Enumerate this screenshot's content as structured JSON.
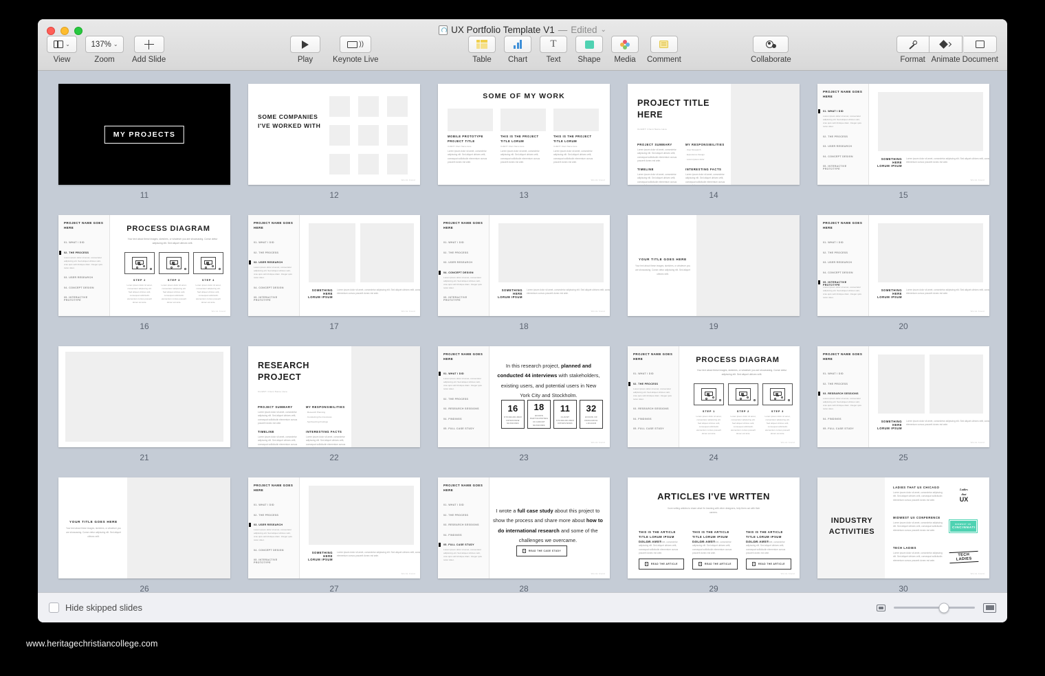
{
  "window": {
    "doc_title": "UX Portfolio Template V1",
    "separator": "—",
    "edited_label": "Edited",
    "caret": "⌄"
  },
  "toolbar": {
    "left": [
      {
        "name": "view",
        "label": "View",
        "icon": "panel-icon",
        "has_caret": true
      },
      {
        "name": "zoom",
        "label": "Zoom",
        "value": "137%",
        "icon": "zoom-value",
        "has_caret": true
      },
      {
        "name": "add-slide",
        "label": "Add Slide",
        "icon": "plus-icon",
        "has_caret": false
      }
    ],
    "center_play": [
      {
        "name": "play",
        "label": "Play",
        "icon": "play-icon"
      },
      {
        "name": "keynote-live",
        "label": "Keynote Live",
        "icon": "keynote-live-icon"
      }
    ],
    "insert": [
      {
        "name": "table",
        "label": "Table",
        "icon": "table-icon",
        "color": "#f0cf4a"
      },
      {
        "name": "chart",
        "label": "Chart",
        "icon": "chart-icon",
        "color": "#3d8fd8"
      },
      {
        "name": "text",
        "label": "Text",
        "icon": "text-icon",
        "color": "#5a5a5a"
      },
      {
        "name": "shape",
        "label": "Shape",
        "icon": "shape-icon",
        "color": "#4fd2b2"
      },
      {
        "name": "media",
        "label": "Media",
        "icon": "media-icon",
        "color": "#e05b7a"
      },
      {
        "name": "comment",
        "label": "Comment",
        "icon": "comment-icon",
        "color": "#f0cf4a"
      }
    ],
    "collaborate": {
      "name": "collaborate",
      "label": "Collaborate",
      "icon": "collaborate-icon"
    },
    "right": [
      {
        "name": "format",
        "label": "Format",
        "icon": "format-brush-icon"
      },
      {
        "name": "animate",
        "label": "Animate",
        "icon": "animate-diamond-icon"
      },
      {
        "name": "document",
        "label": "Document",
        "icon": "document-square-icon"
      }
    ]
  },
  "bottom_bar": {
    "hide_skipped_label": "Hide skipped slides",
    "hide_skipped_checked": false,
    "zoom_small_icon": "small-thumbnails-icon",
    "zoom_large_icon": "large-thumbnails-icon",
    "slider_position_pct": 62
  },
  "watermark": "www.heritagechristiancollege.com",
  "common": {
    "project_name": "PROJECT NAME GOES HERE",
    "footer_mark": "Words brand",
    "something_here": "SOMETHING HERE",
    "lorum_ipsum": "LORUM IPSUM",
    "caption_body": "Lorem ipsum dolor sit amet, consectetur adipiscing elit. Sed aliquet ultrices velit, consequat sollicitudin elementum cursus posuerit donec est ante.",
    "sidebar_body": "Lorem ipsum dolor sit amet, consectetur adipiscing elit. Sed aliquet ultrices velit, cras quis velit tristique diam. Integer quis tortor dolor.",
    "client_line": "CLIENT: Client Name Here",
    "nav_project": [
      "01. WHAT I DID",
      "02. THE PROCESS",
      "03. USER RESEARCH",
      "04. CONCEPT DESIGN",
      "05. INTERACTIVE PROTOTYPE"
    ],
    "nav_research": [
      "01. WHAT I DID",
      "02. THE PROCESS",
      "03. RESEARCH SESSIONS",
      "04. FINDINGS",
      "05. FULL CASE STUDY"
    ],
    "your_title_goes_here": "YOUR TITLE GOES HERE",
    "your_title_body": "Your text about these images, sketches, or whatever you are showcasing. Conse ctetur adipiscing elit. Sed aliquet ultrices velit."
  },
  "slides": [
    {
      "number": "11",
      "name": "my-projects-cover",
      "layout": "cover-dark",
      "title": "MY PROJECTS"
    },
    {
      "number": "12",
      "name": "companies-worked-with",
      "layout": "companies",
      "title": "SOME COMPANIES I'VE WORKED WITH",
      "logo_slots": 9
    },
    {
      "number": "13",
      "name": "some-of-my-work",
      "layout": "work-grid",
      "title": "SOME OF MY WORK",
      "cards": [
        {
          "title": "MOBILE PROTOTYPE PROJECT TITLE",
          "client": "CLIENT: Client Name Here"
        },
        {
          "title": "THIS IS THE PROJECT TITLE LORUM",
          "client": "CLIENT: Client Name Here"
        },
        {
          "title": "THIS IS THE PROJECT TITLE LORUM",
          "client": "CLIENT: Client Name Here"
        }
      ]
    },
    {
      "number": "14",
      "name": "project-title-intro",
      "layout": "project-intro",
      "title": "PROJECT TITLE HERE",
      "client": "CLIENT: Client Name Here",
      "blocks": [
        {
          "heading": "PROJECT SUMMARY",
          "type": "paragraph"
        },
        {
          "heading": "MY RESPONSIBILITIES",
          "type": "list",
          "items": [
            "User Research",
            "Experience Design",
            "Lorem ipsum dolor"
          ]
        },
        {
          "heading": "TIMELINE",
          "type": "paragraph"
        },
        {
          "heading": "INTERESTING FACTS",
          "type": "paragraph"
        }
      ]
    },
    {
      "number": "15",
      "name": "project-image-single",
      "layout": "nav-image-single",
      "active": 0
    },
    {
      "number": "16",
      "name": "process-diagram-a",
      "layout": "nav-process",
      "active": 1,
      "title": "PROCESS DIAGRAM",
      "subtitle": "Your text about these images, sketches, or whatever you are showcasing. Conse ctetur adipiscing elit. Sed aliquet ultrices velit.",
      "steps": [
        "STEP 2",
        "STEP 3",
        "STEP 4"
      ]
    },
    {
      "number": "17",
      "name": "project-image-double",
      "layout": "nav-image-double",
      "active": 2
    },
    {
      "number": "18",
      "name": "project-image-wide",
      "layout": "nav-image-single",
      "active": 3
    },
    {
      "number": "19",
      "name": "title-text-left",
      "layout": "title-left"
    },
    {
      "number": "20",
      "name": "project-image-tall",
      "layout": "nav-image-single",
      "active": 4
    },
    {
      "number": "21",
      "name": "blank-image-slide",
      "layout": "blank-image"
    },
    {
      "number": "22",
      "name": "research-project-intro",
      "layout": "project-intro",
      "title": "RESEARCH PROJECT",
      "client": "CLIENT: Client Name Here",
      "blocks": [
        {
          "heading": "PROJECT SUMMARY",
          "type": "paragraph"
        },
        {
          "heading": "MY RESPONSIBILITIES",
          "type": "list",
          "items": [
            "Research Planning",
            "Conducting the Interviews",
            "Synthesizing Findings"
          ]
        },
        {
          "heading": "TIMELINE",
          "type": "paragraph"
        },
        {
          "heading": "INTERESTING FACTS",
          "type": "paragraph"
        }
      ]
    },
    {
      "number": "23",
      "name": "research-stats",
      "layout": "stats",
      "nav": "research",
      "active": 0,
      "lead_html": "In this research project, <b>planned and conducted 44 interviews</b> with stakeholders, existing users, and potential users in New York City and Stockholm.",
      "stats": [
        {
          "value": "16",
          "label": "STAKEHOLDER INTERVIEW SESSIONS"
        },
        {
          "value": "18",
          "label": "HOURS PARTICIPATING IN GROUP SESSIONS"
        },
        {
          "value": "11",
          "label": "CLIENT STAKEHOLDER INTERVIEWS"
        },
        {
          "value": "32",
          "label": "HOURS OF RESEARCH LOGGED"
        }
      ]
    },
    {
      "number": "24",
      "name": "process-diagram-b",
      "layout": "nav-process",
      "nav": "research",
      "active": 1,
      "title": "PROCESS DIAGRAM",
      "subtitle": "Your text about these images, sketches, or whatever you are showcasing. Conse ctetur adipiscing elit. Sed aliquet ultrices velit.",
      "steps": [
        "STEP 1",
        "STEP 2",
        "STEP 3"
      ]
    },
    {
      "number": "25",
      "name": "research-image-double",
      "layout": "nav-image-double",
      "nav": "research",
      "active": 2
    },
    {
      "number": "26",
      "name": "title-text-left-2",
      "layout": "title-left"
    },
    {
      "number": "27",
      "name": "project-image-caption",
      "layout": "nav-image-single",
      "active": 2
    },
    {
      "number": "28",
      "name": "full-case-study",
      "layout": "case-study",
      "nav": "research",
      "active": 4,
      "lead_html": "I wrote a <b>full case study</b> about this project to show the process and share more about <b>how to do international research</b> and some of the challenges we overcame.",
      "button_label": "READ THE CASE STUDY"
    },
    {
      "number": "29",
      "name": "articles-written",
      "layout": "articles",
      "title": "ARTICLES I'VE WRTTEN",
      "subtitle": "I love writing articles to share what I'm learning with other designers, help them out with their careers.",
      "articles": [
        {
          "title": "THIS IS THE ARTICLE TITLE LORUM IPSUM DOLOR AMET",
          "button": "READ THE ARTICLE"
        },
        {
          "title": "THIS IS THE ARTICLE TITLE LORUM IPSUM DOLOR AMET",
          "button": "READ THE ARTICLE"
        },
        {
          "title": "THIS IS THE ARTICLE TITLE LORUM IPSUM DOLOR AMET",
          "button": "READ THE ARTICLE"
        }
      ]
    },
    {
      "number": "30",
      "name": "industry-activities",
      "layout": "industry",
      "title": "INDUSTRY ACTIVITIES",
      "entries": [
        {
          "heading": "LADIES THAT UX CHICAGO",
          "logo": "ladies-that-ux-logo",
          "logo_text": "UX"
        },
        {
          "heading": "MIDWEST UX CONFERENCE",
          "logo": "midwest-ux-cincinnati-logo",
          "logo_text": "CINCINNATI"
        },
        {
          "heading": "TECH LADIES",
          "logo": "tech-ladies-logo",
          "logo_text": "TECH LADIES"
        }
      ]
    }
  ]
}
